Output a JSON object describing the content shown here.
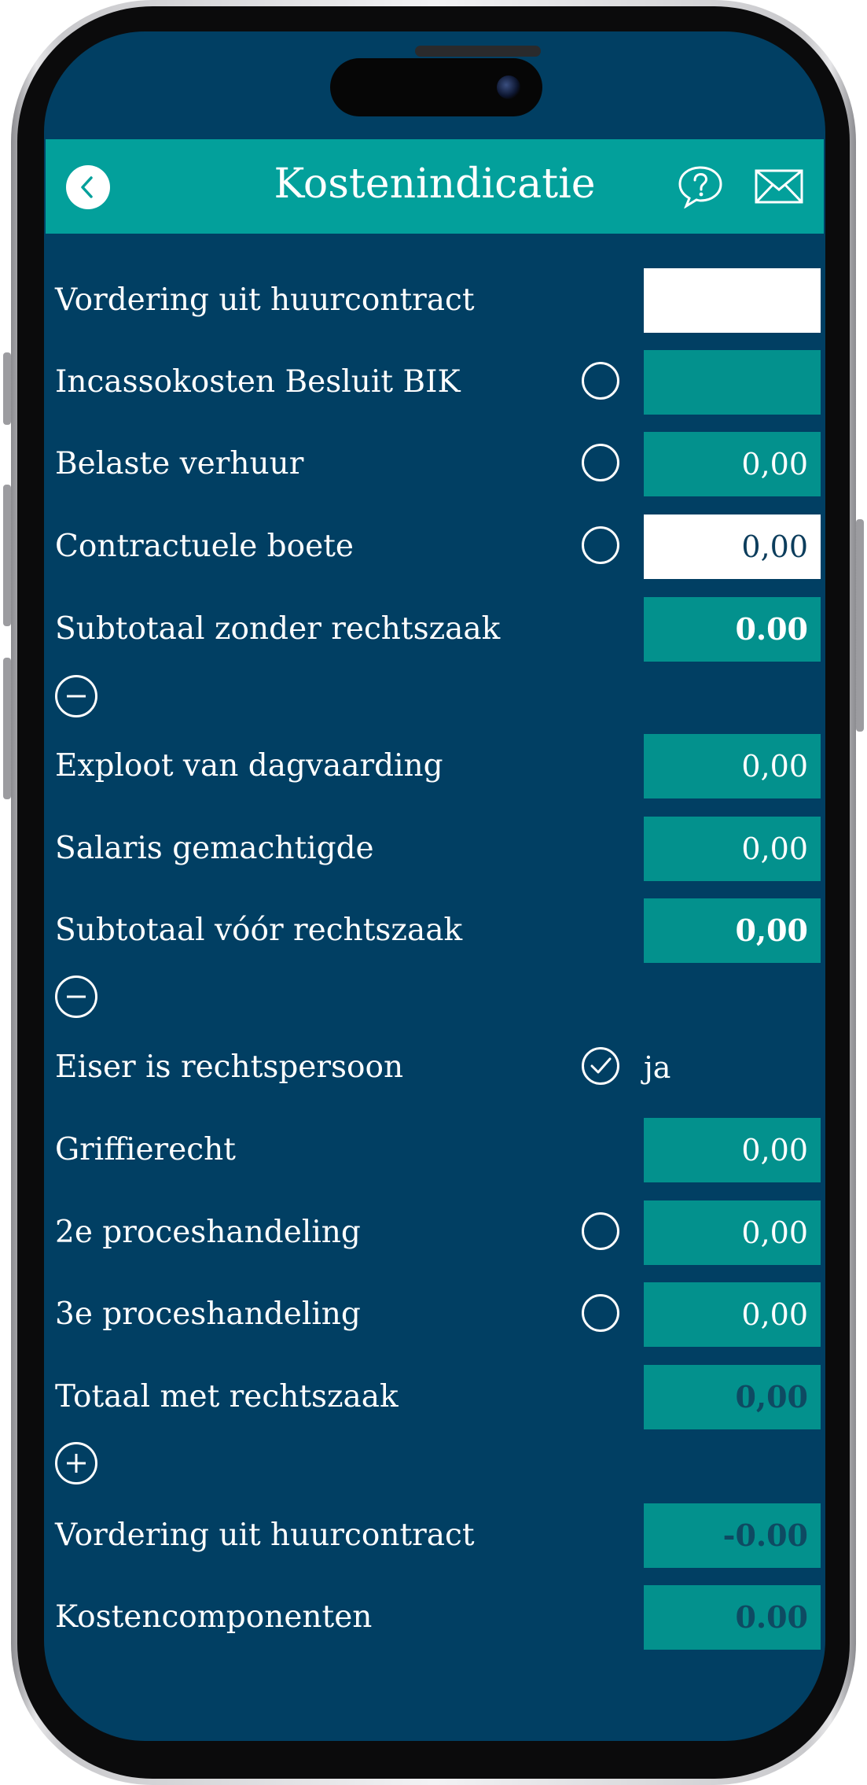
{
  "header": {
    "title": "Kostenindicatie",
    "back_icon": "chevron-left-icon",
    "help_icon": "question-bubble-icon",
    "mail_icon": "envelope-icon",
    "background": "#03a09b"
  },
  "colors": {
    "screen_background": "#013f63",
    "field_teal": "#03918d",
    "field_white": "#ffffff",
    "text": "#ffffff"
  },
  "section1": {
    "rows": [
      {
        "label": "Vordering uit huurcontract",
        "value": ""
      },
      {
        "label": "Incassokosten Besluit BIK",
        "value": ""
      },
      {
        "label": "Belaste verhuur",
        "value": "0,00"
      },
      {
        "label": "Contractuele boete",
        "value": "0,00"
      },
      {
        "label": "Subtotaal zonder rechtszaak",
        "value": "0.00"
      }
    ],
    "toggle_icon": "minus-circle-icon"
  },
  "section2": {
    "rows": [
      {
        "label": "Exploot van dagvaarding",
        "value": "0,00"
      },
      {
        "label": "Salaris gemachtigde",
        "value": "0,00"
      },
      {
        "label": "Subtotaal vóór rechtszaak",
        "value": "0,00"
      }
    ],
    "toggle_icon": "minus-circle-icon"
  },
  "section3": {
    "rows": [
      {
        "label": "Eiser is rechtspersoon",
        "value": "ja",
        "checked": true
      },
      {
        "label": "Griffierecht",
        "value": "0,00"
      },
      {
        "label": "2e proceshandeling",
        "value": "0,00"
      },
      {
        "label": "3e proceshandeling",
        "value": "0,00"
      },
      {
        "label": "Totaal met rechtszaak",
        "value": "0,00"
      }
    ],
    "toggle_icon": "plus-circle-icon"
  },
  "section4": {
    "rows": [
      {
        "label": "Vordering uit huurcontract",
        "value": "-0.00"
      },
      {
        "label": "Kostencomponenten",
        "value": "0.00"
      }
    ]
  }
}
